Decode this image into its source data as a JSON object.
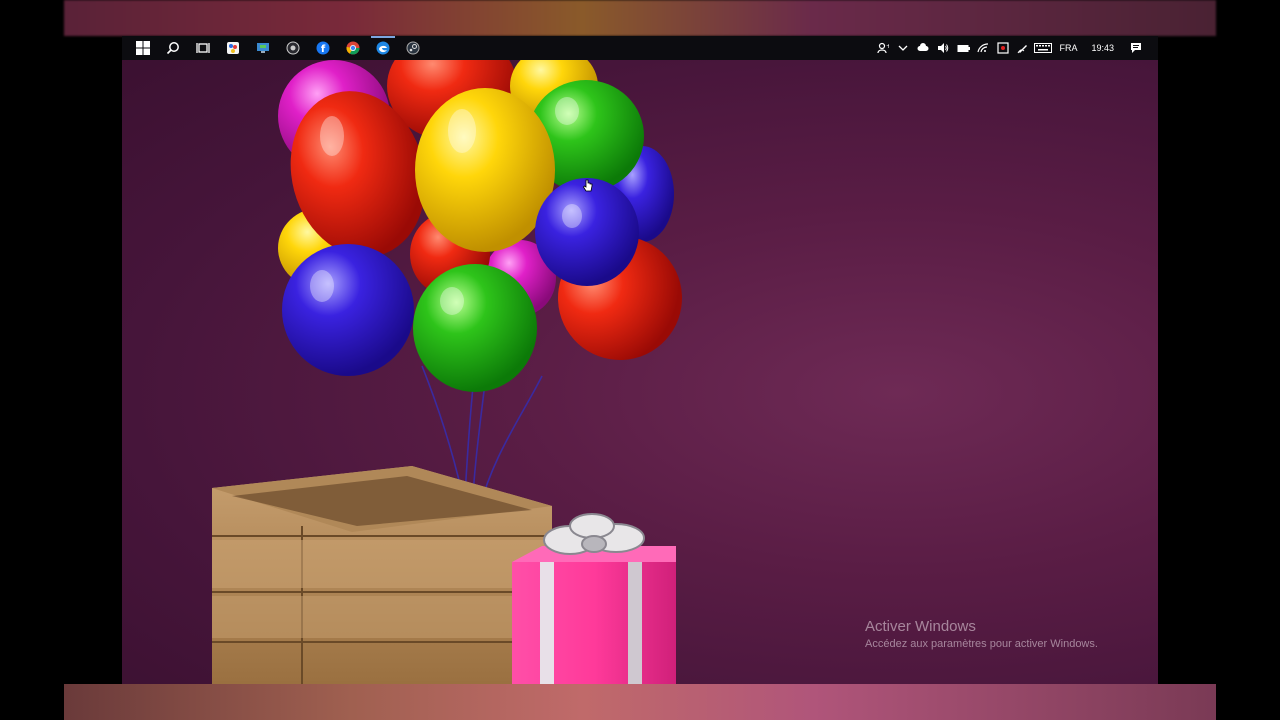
{
  "taskbar": {
    "pinned_apps": [
      {
        "icon": "windows-start-icon"
      },
      {
        "icon": "search-icon"
      },
      {
        "icon": "task-view-icon"
      },
      {
        "icon": "paint-app-icon"
      },
      {
        "icon": "monitor-app-icon"
      },
      {
        "icon": "obs-app-icon"
      },
      {
        "icon": "facebook-icon"
      },
      {
        "icon": "chrome-icon"
      },
      {
        "icon": "edge-icon"
      },
      {
        "icon": "steam-icon"
      }
    ],
    "tray": {
      "language": "FRA",
      "time": "19:43",
      "icons": [
        "people-icon",
        "chevron-up-icon",
        "cloud-icon",
        "volume-icon",
        "battery-icon",
        "wifi-icon",
        "security-icon",
        "pen-icon",
        "keyboard-icon"
      ]
    }
  },
  "watermark": {
    "title": "Activer Windows",
    "subtitle": "Accédez aux paramètres pour activer Windows."
  },
  "colors": {
    "taskbar": "#0c0c10",
    "wallpaper": "#5a1d45",
    "accent": "#7aa7e0"
  }
}
